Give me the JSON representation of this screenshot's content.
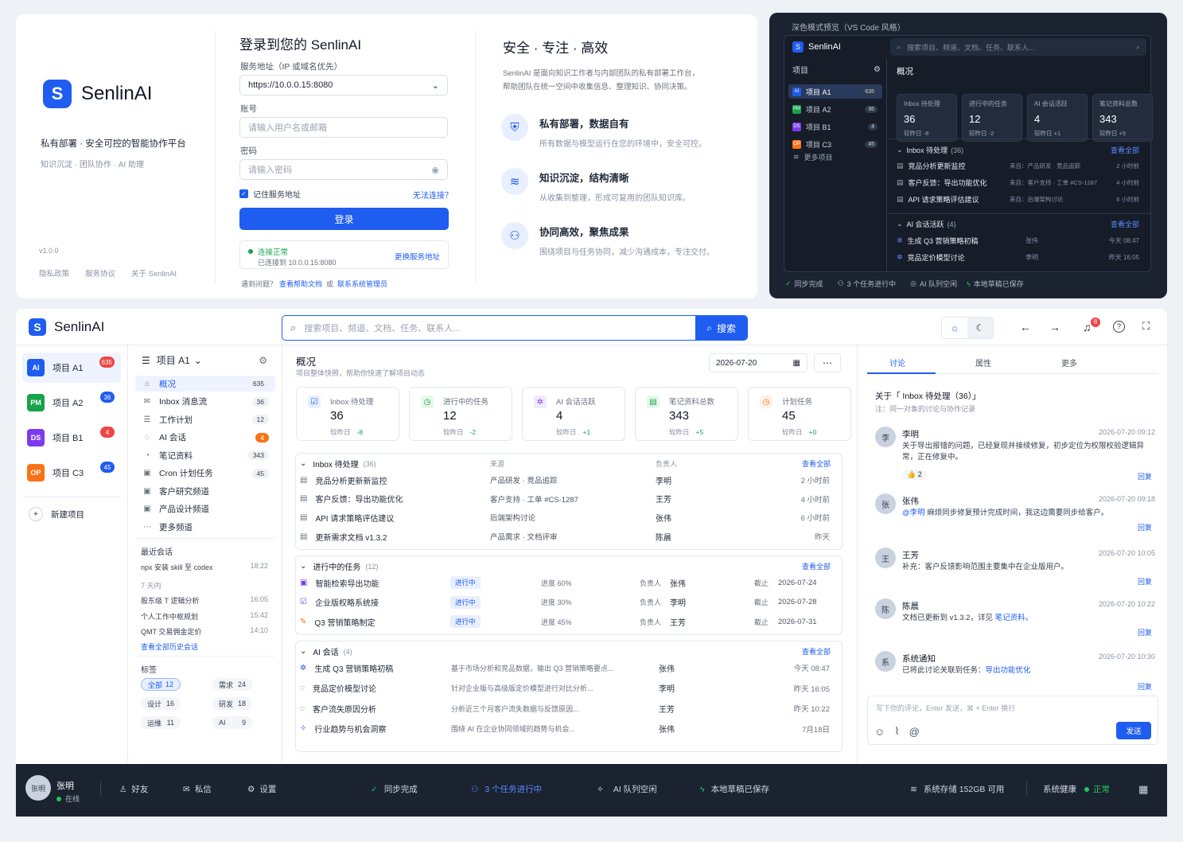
{
  "login": {
    "brand": "SenlinAI",
    "tagline": "私有部署 · 安全可控的智能协作平台",
    "sub_tagline": "知识沉淀 · 团队协作 · AI 助理",
    "version": "v1.0.0",
    "footer_links": [
      "隐私政策",
      "服务协议",
      "关于 SenlinAI"
    ],
    "title": "登录到您的 SenlinAI",
    "server_label": "服务地址（IP 或域名优先）",
    "server_value": "https://10.0.0.15:8080",
    "account_label": "账号",
    "account_placeholder": "请输入用户名或邮箱",
    "password_label": "密码",
    "password_placeholder": "请输入密码",
    "remember_label": "记住服务地址",
    "cant_connect": "无法连接？",
    "login_button": "登录",
    "status_title": "连接正常",
    "status_detail": "已连接到 10.0.0.15:8080",
    "change_server": "更换服务地址",
    "help_prefix": "遇到问题？",
    "help_docs": "查看帮助文档",
    "help_or": "或",
    "help_admin": "联系系统管理员",
    "promo_title": "安全 · 专注 · 高效",
    "promo_desc1": "SenlinAI 是面向知识工作者与内部团队的私有部署工作台，",
    "promo_desc2": "帮助团队在统一空间中收集信息、整理知识、协同决策。",
    "features": [
      {
        "title": "私有部署，数据自有",
        "desc": "所有数据与模型运行在您的环境中，安全可控。"
      },
      {
        "title": "知识沉淀，结构清晰",
        "desc": "从收集到整理，形成可复用的团队知识库。"
      },
      {
        "title": "协同高效，聚焦成果",
        "desc": "围绕项目与任务协同，减少沟通成本，专注交付。"
      }
    ]
  },
  "dark": {
    "caption": "深色模式预览（VS Code 风格）",
    "brand": "SenlinAI",
    "search_placeholder": "搜索项目、频道、文档、任务、联系人...",
    "projects_label": "项目",
    "projects": [
      {
        "abbr": "AI",
        "name": "项目 A1",
        "count": "635",
        "color": "#1f5cf0"
      },
      {
        "abbr": "PM",
        "name": "项目 A2",
        "count": "36",
        "color": "#16a34a"
      },
      {
        "abbr": "DS",
        "name": "项目 B1",
        "count": "4",
        "color": "#7c3aed"
      },
      {
        "abbr": "OP",
        "name": "项目 C3",
        "count": "45",
        "color": "#f97316"
      }
    ],
    "more_projects": "更多项目",
    "overview": "概况",
    "stats": [
      {
        "label": "Inbox 待处理",
        "value": "36",
        "delta": "较昨日 -8"
      },
      {
        "label": "进行中的任务",
        "value": "12",
        "delta": "较昨日 -2"
      },
      {
        "label": "AI 会话活跃",
        "value": "4",
        "delta": "较昨日 +1"
      },
      {
        "label": "笔记资料总数",
        "value": "343",
        "delta": "较昨日 +5"
      }
    ],
    "inbox_title": "Inbox 待处理",
    "inbox_count": "(36)",
    "view_all": "查看全部",
    "inbox": [
      {
        "title": "竞品分析更新监控",
        "source": "来自：产品研发 · 竞品追踪",
        "time": "2 小时前"
      },
      {
        "title": "客户反馈：导出功能优化",
        "source": "来自：客户支持 · 工单 #CS-1287",
        "time": "4 小时前"
      },
      {
        "title": "API 请求策略评估建议",
        "source": "来自：后端架构讨论",
        "time": "6 小时前"
      }
    ],
    "ai_title": "AI 会话活跃",
    "ai_count": "(4)",
    "ai": [
      {
        "title": "生成 Q3 营销策略初稿",
        "owner": "张伟",
        "time": "今天 08:47"
      },
      {
        "title": "竞品定价模型讨论",
        "owner": "李明",
        "time": "昨天 16:05"
      }
    ],
    "status": [
      "同步完成",
      "3 个任务进行中",
      "AI 队列空闲",
      "本地草稿已保存"
    ]
  },
  "main": {
    "brand": "SenlinAI",
    "search_placeholder": "搜索项目、频道、文档、任务、联系人...",
    "search_button": "搜索",
    "bell_badge": "8",
    "projects": [
      {
        "abbr": "AI",
        "name": "项目 A1",
        "count": "635",
        "color": "#1f5cf0",
        "badge": "#ef4444"
      },
      {
        "abbr": "PM",
        "name": "项目 A2",
        "count": "36",
        "color": "#16a34a",
        "badge": "#1f5cf0"
      },
      {
        "abbr": "DS",
        "name": "项目 B1",
        "count": "4",
        "color": "#7c3aed",
        "badge": "#ef4444"
      },
      {
        "abbr": "OP",
        "name": "项目 C3",
        "count": "45",
        "color": "#f97316",
        "badge": "#1f5cf0"
      }
    ],
    "new_project": "新建项目",
    "project_title": "项目 A1",
    "channels": [
      {
        "icon": "⌂",
        "name": "概况",
        "count": "635"
      },
      {
        "icon": "✉",
        "name": "Inbox 消息流",
        "count": "36"
      },
      {
        "icon": "☰",
        "name": "工作计划",
        "count": "12"
      },
      {
        "icon": "◌",
        "name": "AI 会话",
        "count": "4"
      },
      {
        "icon": "◔",
        "name": "笔记资料",
        "count": "343"
      },
      {
        "icon": "▣",
        "name": "Cron 计划任务",
        "count": "45"
      },
      {
        "icon": "▣",
        "name": "客户研究频道",
        "count": ""
      },
      {
        "icon": "▣",
        "name": "产品设计频道",
        "count": ""
      },
      {
        "icon": "⋯",
        "name": "更多频道",
        "count": ""
      }
    ],
    "recent_label": "最近会话",
    "recent_top": {
      "title": "npx 安装 skill 至 codex",
      "time": "18:22"
    },
    "recent_group": "7 天内",
    "recent": [
      {
        "title": "股东级 T 逻辑分析",
        "time": "16:05"
      },
      {
        "title": "个人工作中枢规划",
        "time": "15:42"
      },
      {
        "title": "QMT 交易佣金定价",
        "time": "14:10"
      }
    ],
    "recent_all": "查看全部历史会话",
    "tags_label": "标签",
    "tags": [
      {
        "name": "全部",
        "count": "12"
      },
      {
        "name": "需求",
        "count": "24"
      },
      {
        "name": "设计",
        "count": "16"
      },
      {
        "name": "研发",
        "count": "18"
      },
      {
        "name": "运维",
        "count": "11"
      },
      {
        "name": "AI",
        "count": "9"
      }
    ],
    "overview_title": "概况",
    "overview_sub": "项目整体快照，帮助你快速了解项目动态",
    "date": "2026-07-20",
    "stats": [
      {
        "label": "Inbox 待处理",
        "value": "36",
        "delta_label": "较昨日",
        "delta": "-8",
        "icon": "☑",
        "color": "#1f5cf0",
        "bg": "#e8efff"
      },
      {
        "label": "进行中的任务",
        "value": "12",
        "delta_label": "较昨日",
        "delta": "-2",
        "icon": "◷",
        "color": "#16a34a",
        "bg": "#e6f7ec"
      },
      {
        "label": "AI 会话活跃",
        "value": "4",
        "delta_label": "较昨日",
        "delta": "+1",
        "icon": "✲",
        "color": "#7c3aed",
        "bg": "#f1eafe"
      },
      {
        "label": "笔记资料总数",
        "value": "343",
        "delta_label": "较昨日",
        "delta": "+5",
        "icon": "▤",
        "color": "#16a34a",
        "bg": "#e6f7ec"
      },
      {
        "label": "计划任务",
        "value": "45",
        "delta_label": "较昨日",
        "delta": "+0",
        "icon": "◷",
        "color": "#f97316",
        "bg": "#fff1e6"
      }
    ],
    "inbox_title": "Inbox 待处理",
    "inbox_count": "(36)",
    "col_source": "来源",
    "col_owner": "负责人",
    "view_all": "查看全部",
    "inbox": [
      {
        "title": "竞品分析更新新监控",
        "source": "产品研发 · 竞品追踪",
        "owner": "李明",
        "time": "2 小时前"
      },
      {
        "title": "客户反馈：导出功能优化",
        "source": "客户支持 · 工单 #CS-1287",
        "owner": "王芳",
        "time": "4 小时前"
      },
      {
        "title": "API 请求策略评估建议",
        "source": "后端架构讨论",
        "owner": "张伟",
        "time": "6 小时前"
      },
      {
        "title": "更新需求文档 v1.3.2",
        "source": "产品需求 · 文档评审",
        "owner": "陈晨",
        "time": "昨天"
      }
    ],
    "tasks_title": "进行中的任务",
    "tasks_count": "(12)",
    "tasks": [
      {
        "title": "智能检索导出功能",
        "status": "进行中",
        "progress": "进度  60%",
        "owner_label": "负责人",
        "owner": "张伟",
        "due_label": "截止",
        "due": "2026-07-24",
        "icon": "▣",
        "color": "#7c3aed"
      },
      {
        "title": "企业版权略系统接",
        "status": "进行中",
        "progress": "进度  30%",
        "owner_label": "负责人",
        "owner": "李明",
        "due_label": "截止",
        "due": "2026-07-28",
        "icon": "☑",
        "color": "#7c3aed"
      },
      {
        "title": "Q3 营销策略制定",
        "status": "进行中",
        "progress": "进度  45%",
        "owner_label": "负责人",
        "owner": "王芳",
        "due_label": "截止",
        "due": "2026-07-31",
        "icon": "✎",
        "color": "#f97316"
      }
    ],
    "ai_title": "AI 会话",
    "ai_count": "(4)",
    "ai": [
      {
        "title": "生成 Q3 营销策略初稿",
        "desc": "基于市场分析和竞品数据，输出 Q3 营销策略要点...",
        "owner": "张伟",
        "time": "今天 08:47"
      },
      {
        "title": "竞品定价模型讨论",
        "desc": "针对企业版与高级版定价模型进行对比分析...",
        "owner": "李明",
        "time": "昨天 16:05"
      },
      {
        "title": "客户流失原因分析",
        "desc": "分析近三个月客户流失数据与反馈原因...",
        "owner": "王芳",
        "time": "昨天 10:22"
      },
      {
        "title": "行业趋势与机会洞察",
        "desc": "围绕 AI 在企业协同领域的趋势与机会...",
        "owner": "张伟",
        "time": "7月18日"
      }
    ],
    "tabs": [
      "讨论",
      "属性",
      "更多"
    ],
    "discussion_title": "关于「 Inbox 待处理（36）」",
    "discussion_note": "注：同一对象的讨论与协作记录",
    "comments": [
      {
        "name": "李明",
        "time": "2026-07-20 09:12",
        "body": "关于导出报错的问题，已经复现并接续修复，初步定位为权限校验逻辑异常，正在修复中。",
        "reaction": "👍 2",
        "reply": "回复"
      },
      {
        "name": "张伟",
        "time": "2026-07-20 09:18",
        "mention": "@李明",
        "body": " 麻烦同步修复预计完成时间，我这边需要同步给客户。",
        "reply": "回复"
      },
      {
        "name": "王芳",
        "time": "2026-07-20 10:05",
        "body": "补充：客户反馈影响范围主要集中在企业版用户。",
        "reply": "回复"
      },
      {
        "name": "陈晨",
        "time": "2026-07-20 10:22",
        "body": "文档已更新到 v1.3.2，详见 ",
        "link": "笔记资料。",
        "reply": "回复"
      },
      {
        "name": "系统通知",
        "time": "2026-07-20 10:30",
        "body": "已将此讨论关联到任务：",
        "link": "导出功能优化",
        "reply": "回复"
      }
    ],
    "composer_placeholder": "写下你的评论，Enter 发送，⌘ + Enter 换行",
    "send_button": "发送"
  },
  "footer": {
    "user_name": "张明",
    "user_status": "在线",
    "friends": "好友",
    "messages": "私信",
    "settings": "设置",
    "sync": "同步完成",
    "tasks": "3 个任务进行中",
    "ai_queue": "AI 队列空闲",
    "draft": "本地草稿已保存",
    "storage": "系统存储  152GB 可用",
    "health_label": "系统健康",
    "health_value": "正常"
  }
}
